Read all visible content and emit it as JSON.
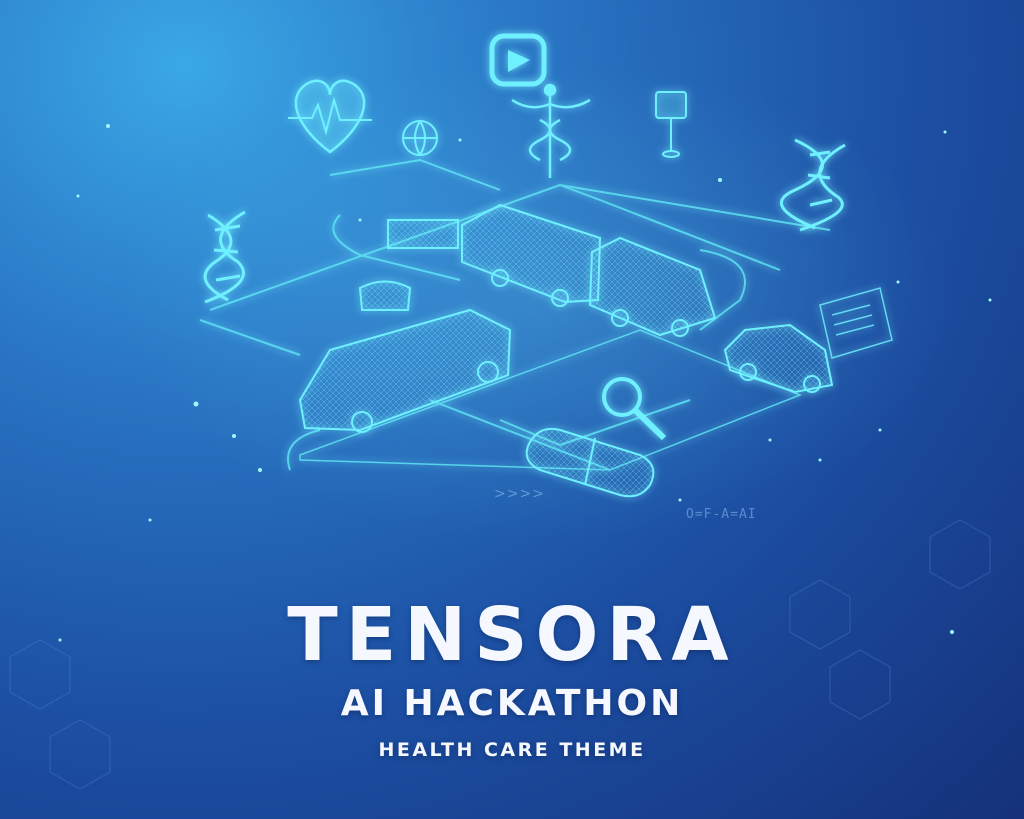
{
  "poster": {
    "title": "TENSORA",
    "subtitle": "AI HACKATHON",
    "theme": "HEALTH CARE THEME",
    "formula_text": "O=F-A=AI",
    "chevrons_text": ">>>>"
  },
  "colors": {
    "background_light": "#3aa8e6",
    "background_dark": "#15317a",
    "hologram": "#5fe6f5",
    "text": "#f5f8ff"
  },
  "icons": [
    "heart-rate-icon",
    "play-button-icon",
    "caduceus-icon",
    "dna-helix-icon",
    "bus-icon",
    "car-icon",
    "pill-capsule-icon",
    "magnifier-icon",
    "medical-report-icon",
    "road-sign-icon",
    "globe-icon"
  ]
}
